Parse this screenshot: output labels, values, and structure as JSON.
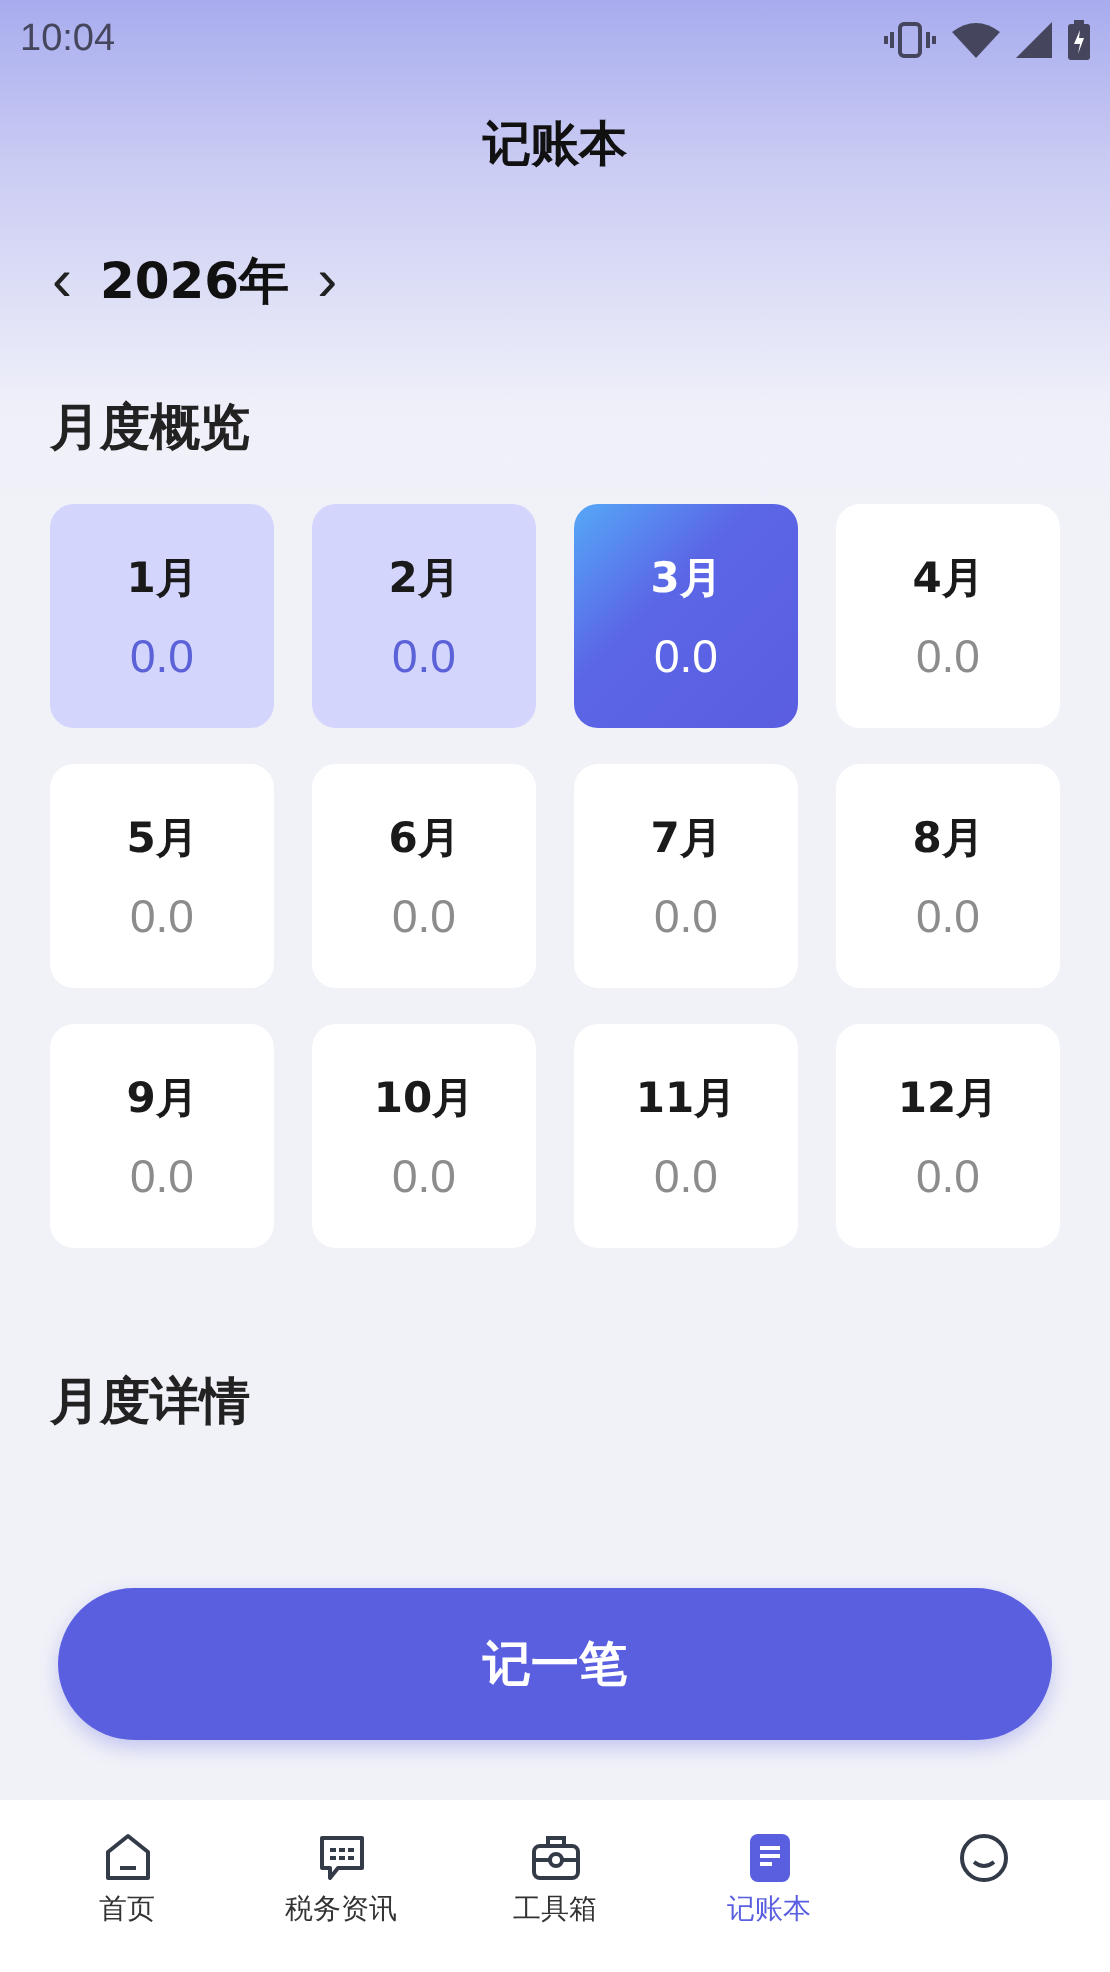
{
  "status_bar": {
    "time": "10:04"
  },
  "header": {
    "title": "记账本"
  },
  "year_picker": {
    "prev": "‹",
    "year": "2026年",
    "next": "›"
  },
  "overview": {
    "title": "月度概览",
    "months": [
      {
        "label": "1月",
        "amount": "0.0",
        "kind": "past"
      },
      {
        "label": "2月",
        "amount": "0.0",
        "kind": "past"
      },
      {
        "label": "3月",
        "amount": "0.0",
        "kind": "current"
      },
      {
        "label": "4月",
        "amount": "0.0",
        "kind": "future"
      },
      {
        "label": "5月",
        "amount": "0.0",
        "kind": "future"
      },
      {
        "label": "6月",
        "amount": "0.0",
        "kind": "future"
      },
      {
        "label": "7月",
        "amount": "0.0",
        "kind": "future"
      },
      {
        "label": "8月",
        "amount": "0.0",
        "kind": "future"
      },
      {
        "label": "9月",
        "amount": "0.0",
        "kind": "future"
      },
      {
        "label": "10月",
        "amount": "0.0",
        "kind": "future"
      },
      {
        "label": "11月",
        "amount": "0.0",
        "kind": "future"
      },
      {
        "label": "12月",
        "amount": "0.0",
        "kind": "future"
      }
    ]
  },
  "details": {
    "title": "月度详情"
  },
  "add_button": "记一笔",
  "tab_bar": [
    {
      "kind": "home",
      "label": "首页",
      "selected": false
    },
    {
      "kind": "message",
      "label": "税务资讯",
      "selected": false
    },
    {
      "kind": "toolbox",
      "label": "工具箱",
      "selected": false
    },
    {
      "kind": "document",
      "label": "记账本",
      "selected": true
    },
    {
      "kind": "smile",
      "selected": false
    }
  ]
}
